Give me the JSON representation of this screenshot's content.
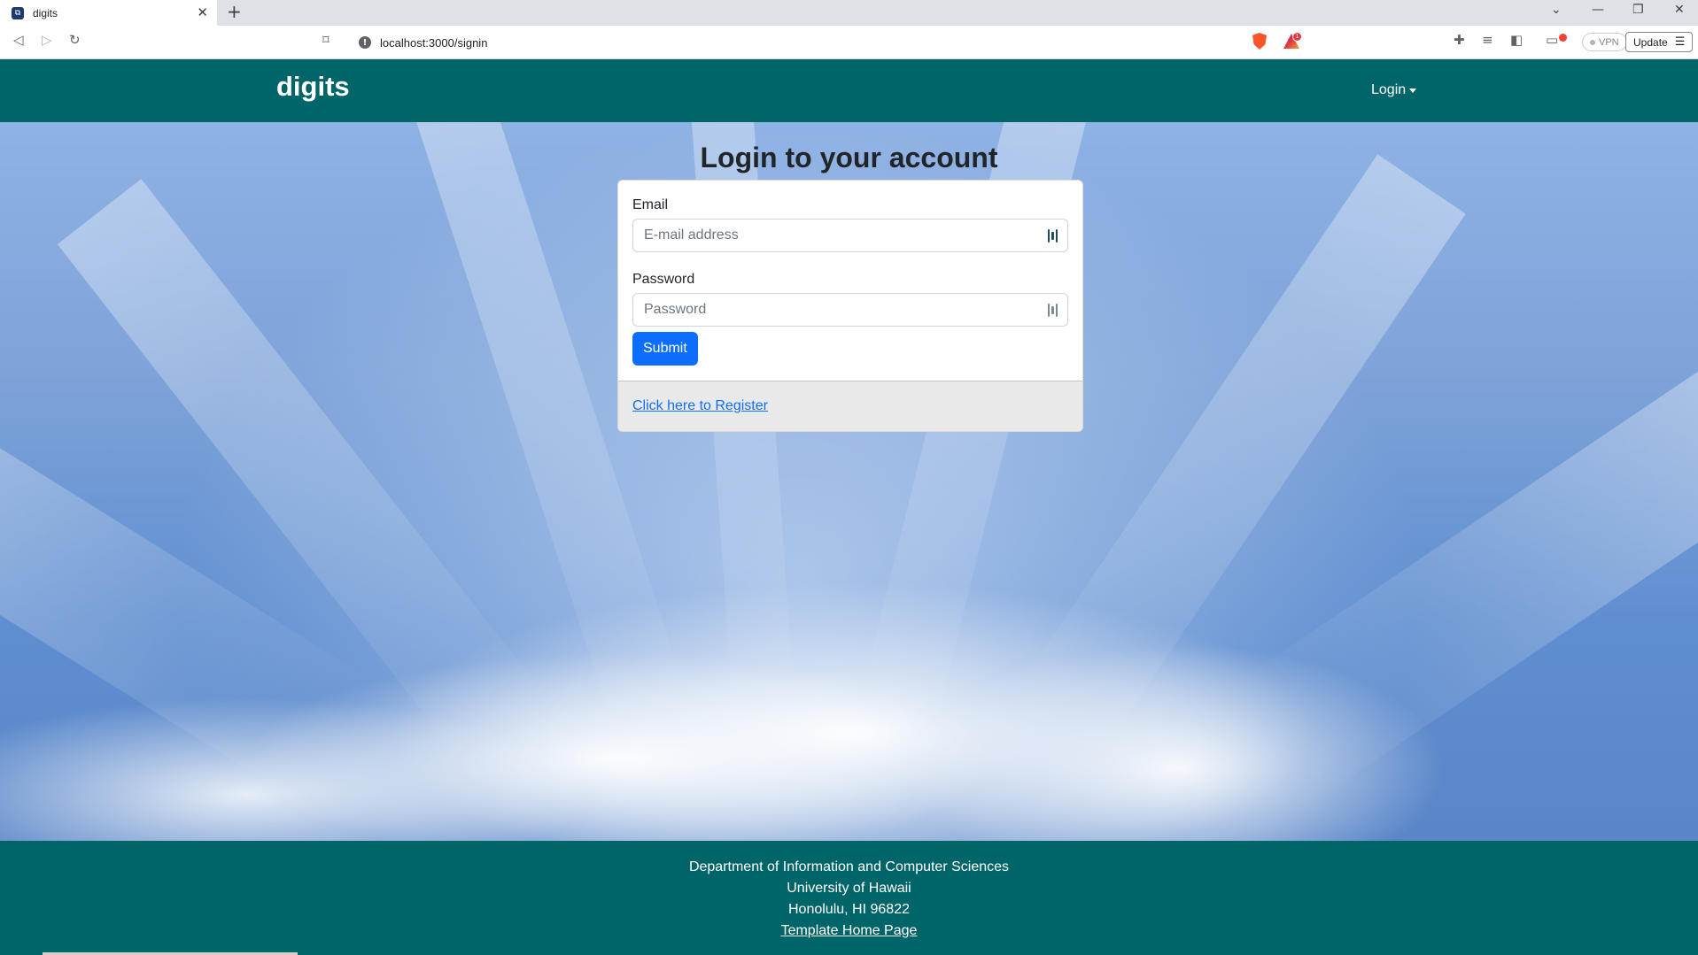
{
  "browser": {
    "tab_title": "digits",
    "favicon_glyph": "⧉",
    "tab_close_glyph": "✕",
    "new_tab_glyph": "+",
    "url": "localhost:3000/signin",
    "vpn_label": "VPN",
    "update_label": "Update",
    "rewards_badge": "1",
    "icons": {
      "back": "◁",
      "forward": "▷",
      "reload": "↻",
      "bookmark": "bookmark-icon",
      "share": "share-icon",
      "extensions": "puzzle-icon",
      "playlist": "playlist-icon",
      "sidebar": "sidebar-icon",
      "wallet": "wallet-icon",
      "menu": "menu-icon",
      "tab_search": "chevron-down-icon",
      "minimize": "minimize-icon",
      "restore": "restore-icon",
      "close": "close-icon"
    },
    "glyphs": {
      "back": "◁",
      "forward": "▷",
      "reload": "↻",
      "bookmark": "⌑",
      "share": "⇪",
      "extensions": "✚",
      "playlist": "≡",
      "sidebar": "◧",
      "wallet": "▭",
      "menu": "☰",
      "tab_search": "⌄",
      "minimize": "—",
      "restore": "❐",
      "close": "✕",
      "info": "!"
    }
  },
  "navbar": {
    "brand": "digits",
    "login_label": "Login",
    "background": "#006568"
  },
  "page": {
    "heading": "Login to your account"
  },
  "form": {
    "email_label": "Email",
    "email_placeholder": "E-mail address",
    "email_value": "",
    "password_label": "Password",
    "password_placeholder": "Password",
    "password_value": "",
    "submit_label": "Submit",
    "register_link": "Click here to Register",
    "accent": "#0d6efd"
  },
  "footer": {
    "line1": "Department of Information and Computer Sciences",
    "line2": "University of Hawaii",
    "line3": "Honolulu, HI 96822",
    "link": "Template Home Page",
    "background": "#006568"
  }
}
